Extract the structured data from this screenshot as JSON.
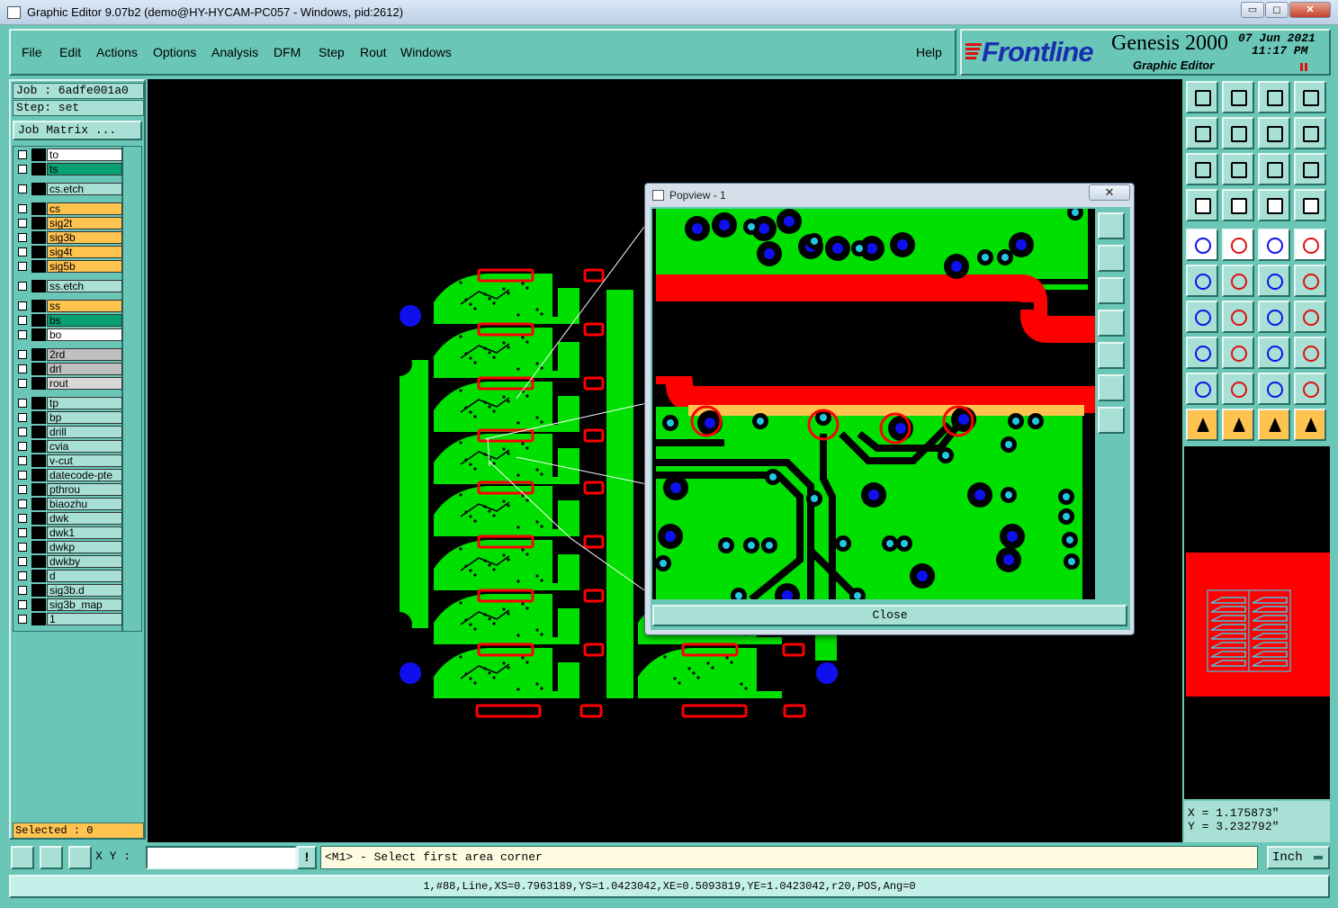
{
  "window": {
    "title": "Graphic Editor 9.07b2 (demo@HY-HYCAM-PC057 - Windows, pid:2612)",
    "minimize": "▭",
    "maximize": "◻",
    "close": "✕"
  },
  "menus": [
    {
      "label": "File"
    },
    {
      "label": "Edit"
    },
    {
      "label": "Actions"
    },
    {
      "label": "Options"
    },
    {
      "label": "Analysis"
    },
    {
      "label": "DFM"
    },
    {
      "label": "Step"
    },
    {
      "label": "Rout"
    },
    {
      "label": "Windows"
    }
  ],
  "help_label": "Help",
  "brand": {
    "logo": "Frontline",
    "product": "Genesis 2000",
    "subtitle": "Graphic Editor",
    "date": "07  Jun  2021",
    "time": "11:17  PM"
  },
  "job": {
    "job_label": "Job : 6adfe001a0",
    "step_label": "Step: set",
    "matrix_button": "Job Matrix ..."
  },
  "layers": [
    {
      "name": "to",
      "bg": "#ffffff",
      "dot": ""
    },
    {
      "name": "ts",
      "bg": "#06a072",
      "dot": ""
    },
    {
      "name": "cs.etch",
      "bg": "#a8e0d6",
      "dot": ""
    },
    {
      "name": "cs",
      "bg": "#ffc34f",
      "dot": ""
    },
    {
      "name": "sig2t",
      "bg": "#ffc34f",
      "dot": ""
    },
    {
      "name": "sig3b",
      "bg": "#ffc34f",
      "dot": "#22cc22"
    },
    {
      "name": "sig4t",
      "bg": "#ffc34f",
      "dot": ""
    },
    {
      "name": "sig5b",
      "bg": "#ffc34f",
      "dot": ""
    },
    {
      "name": "ss.etch",
      "bg": "#a8e0d6",
      "dot": ""
    },
    {
      "name": "ss",
      "bg": "#ffc34f",
      "dot": ""
    },
    {
      "name": "bs",
      "bg": "#06a072",
      "dot": ""
    },
    {
      "name": "bo",
      "bg": "#ffffff",
      "dot": ""
    },
    {
      "name": "2rd",
      "bg": "#c0c0c0",
      "dot": ""
    },
    {
      "name": "drl",
      "bg": "#c0c0c0",
      "dot": "#1010ee"
    },
    {
      "name": "rout",
      "bg": "#d8d8d8",
      "dot": ""
    },
    {
      "name": "tp",
      "bg": "#a8e0d6",
      "dot": ""
    },
    {
      "name": "bp",
      "bg": "#a8e0d6",
      "dot": ""
    },
    {
      "name": "drill",
      "bg": "#a8e0d6",
      "dot": ""
    },
    {
      "name": "cvia",
      "bg": "#a8e0d6",
      "dot": ""
    },
    {
      "name": "v-cut",
      "bg": "#a8e0d6",
      "dot": ""
    },
    {
      "name": "datecode-pte",
      "bg": "#a8e0d6",
      "dot": ""
    },
    {
      "name": "pthrou",
      "bg": "#a8e0d6",
      "dot": ""
    },
    {
      "name": "biaozhu",
      "bg": "#a8e0d6",
      "dot": ""
    },
    {
      "name": "dwk",
      "bg": "#a8e0d6",
      "dot": ""
    },
    {
      "name": "dwk1",
      "bg": "#a8e0d6",
      "dot": ""
    },
    {
      "name": "dwkp",
      "bg": "#a8e0d6",
      "dot": ""
    },
    {
      "name": "dwkby",
      "bg": "#a8e0d6",
      "dot": ""
    },
    {
      "name": "d",
      "bg": "#a8e0d6",
      "dot": ""
    },
    {
      "name": "sig3b.d",
      "bg": "#a8e0d6",
      "dot": ""
    },
    {
      "name": "sig3b_map",
      "bg": "#a8e0d6",
      "dot": ""
    },
    {
      "name": "1",
      "bg": "#a8e0d6",
      "dot": "#ee1010"
    }
  ],
  "selected_label": "Selected : 0",
  "popview": {
    "title": "Popview - 1",
    "close_button": "Close"
  },
  "coords": {
    "x": "X = 1.175873\"",
    "y": "Y = 3.232792\""
  },
  "command": {
    "xy_label": "X Y :",
    "xy_value": "",
    "message": "<M1> - Select first area corner",
    "unit": "Inch"
  },
  "status": "1,#88,Line,XS=0.7963189,YS=1.0423042,XE=0.5093819,YE=1.0423042,r20,POS,Ang=0",
  "colors": {
    "copper": "#00e000",
    "pad_outline": "#ff0000",
    "drill": "#1010ee",
    "via": "#22c8e0",
    "silk": "#ffc34f"
  },
  "icons": {
    "toolbar": [
      "open-job-icon",
      "save-icon",
      "home-icon",
      "window-icon",
      "step-left-icon",
      "step-right-icon",
      "undo-icon",
      "redo-icon",
      "fit-icon",
      "center-icon",
      "ratio-icon",
      "help-icon",
      "pen-icon",
      "probe-icon",
      "snap-icon",
      "snap-grid-icon",
      "point-icon",
      "line-icon",
      "ruler-icon",
      "record-icon",
      "connect-icon",
      "cross-icon",
      "route-icon",
      "move-icon",
      "angle-icon",
      "diag-icon",
      "rotate-icon",
      "mirror-icon",
      "add-pad-icon",
      "measure-icon",
      "align-icon",
      "copy-icon",
      "triangle-icon",
      "arc-icon",
      "arc2-icon",
      "arc3-icon",
      "pointer-icon",
      "pointer2-icon",
      "pointer3-icon",
      "pointer4-icon"
    ]
  }
}
